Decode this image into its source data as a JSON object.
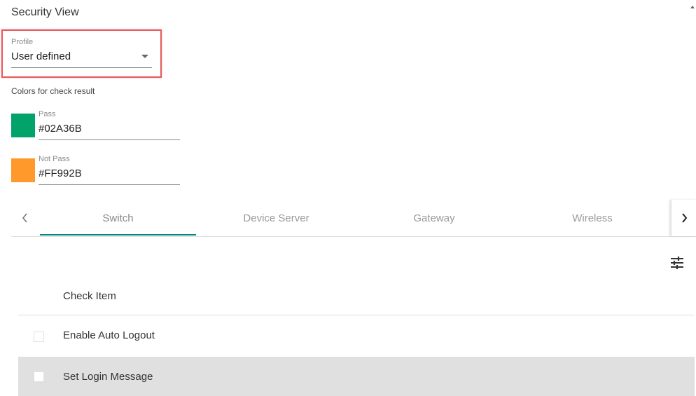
{
  "header": {
    "title": "Security View"
  },
  "profile": {
    "label": "Profile",
    "value": "User defined"
  },
  "colors": {
    "title": "Colors for check result",
    "pass": {
      "label": "Pass",
      "value": "#02A36B",
      "swatch": "#02A36B"
    },
    "not_pass": {
      "label": "Not Pass",
      "value": "#FF992B",
      "swatch": "#FF992B"
    }
  },
  "tabs": [
    {
      "label": "Switch",
      "active": true
    },
    {
      "label": "Device Server",
      "active": false
    },
    {
      "label": "Gateway",
      "active": false
    },
    {
      "label": "Wireless",
      "active": false
    }
  ],
  "table": {
    "header": "Check Item",
    "rows": [
      {
        "label": "Enable Auto Logout",
        "selected": false
      },
      {
        "label": "Set Login Message",
        "selected": true
      }
    ]
  },
  "accent_color": "#008787"
}
